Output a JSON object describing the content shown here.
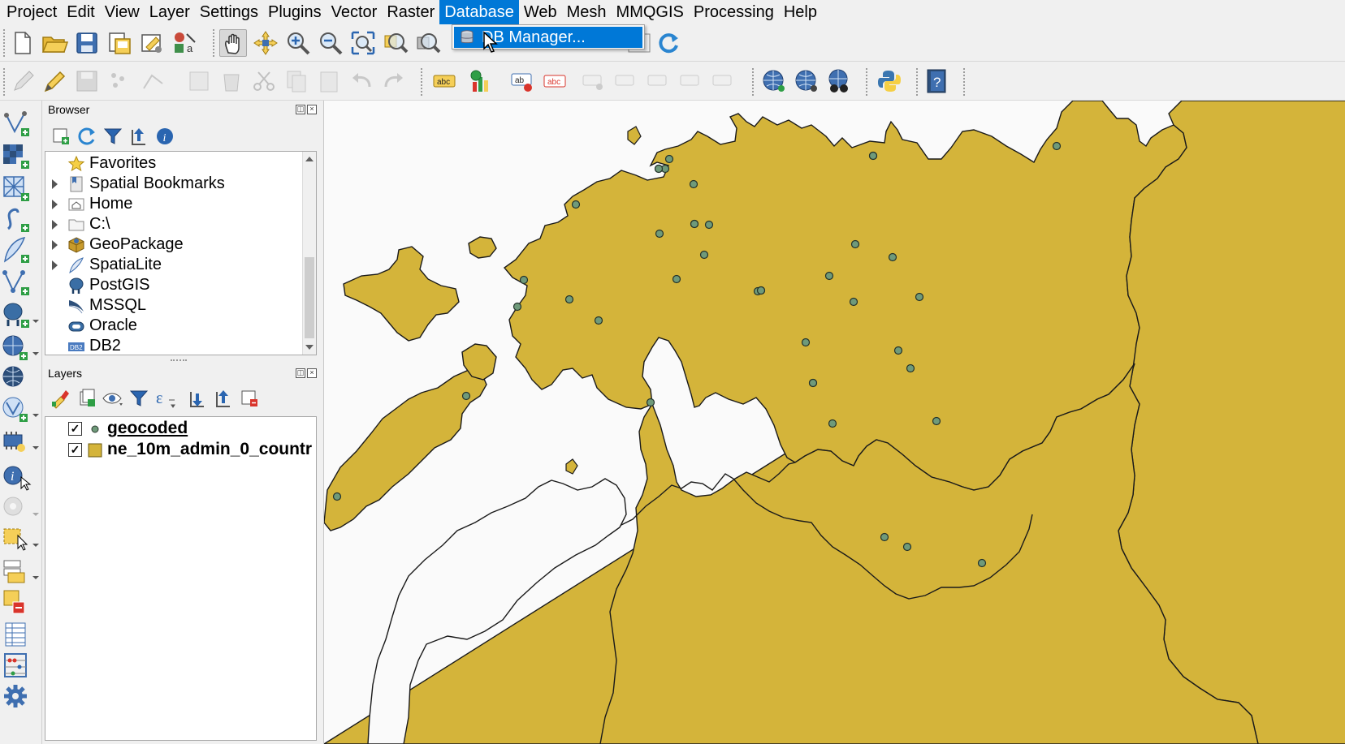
{
  "menu": {
    "items": [
      "Project",
      "Edit",
      "View",
      "Layer",
      "Settings",
      "Plugins",
      "Vector",
      "Raster",
      "Database",
      "Web",
      "Mesh",
      "MMQGIS",
      "Processing",
      "Help"
    ],
    "active": "Database"
  },
  "database_menu": {
    "items": [
      {
        "label": "DB Manager...",
        "icon": "db-manager-icon",
        "highlighted": true
      }
    ]
  },
  "browser": {
    "title": "Browser",
    "items": [
      {
        "label": "Favorites",
        "icon": "star-icon",
        "expandable": false
      },
      {
        "label": "Spatial Bookmarks",
        "icon": "bookmark-icon",
        "expandable": true
      },
      {
        "label": "Home",
        "icon": "home-folder-icon",
        "expandable": true
      },
      {
        "label": "C:\\",
        "icon": "drive-folder-icon",
        "expandable": true
      },
      {
        "label": "GeoPackage",
        "icon": "geopackage-icon",
        "expandable": true
      },
      {
        "label": "SpatiaLite",
        "icon": "spatialite-icon",
        "expandable": true
      },
      {
        "label": "PostGIS",
        "icon": "postgis-elephant-icon",
        "expandable": false
      },
      {
        "label": "MSSQL",
        "icon": "mssql-icon",
        "expandable": false
      },
      {
        "label": "Oracle",
        "icon": "oracle-icon",
        "expandable": false
      },
      {
        "label": "DB2",
        "icon": "db2-icon",
        "expandable": false
      }
    ]
  },
  "layers": {
    "title": "Layers",
    "items": [
      {
        "label": "geocoded",
        "checked": true,
        "symbol": "point",
        "color": "#6f9a7a",
        "active": true
      },
      {
        "label": "ne_10m_admin_0_countr",
        "checked": true,
        "symbol": "polygon",
        "color": "#d4b43a",
        "active": false
      }
    ]
  },
  "map": {
    "land_color": "#d4b43a",
    "water_color": "#fafafa",
    "point_color": "#6f9a7a",
    "point_count": 41
  }
}
